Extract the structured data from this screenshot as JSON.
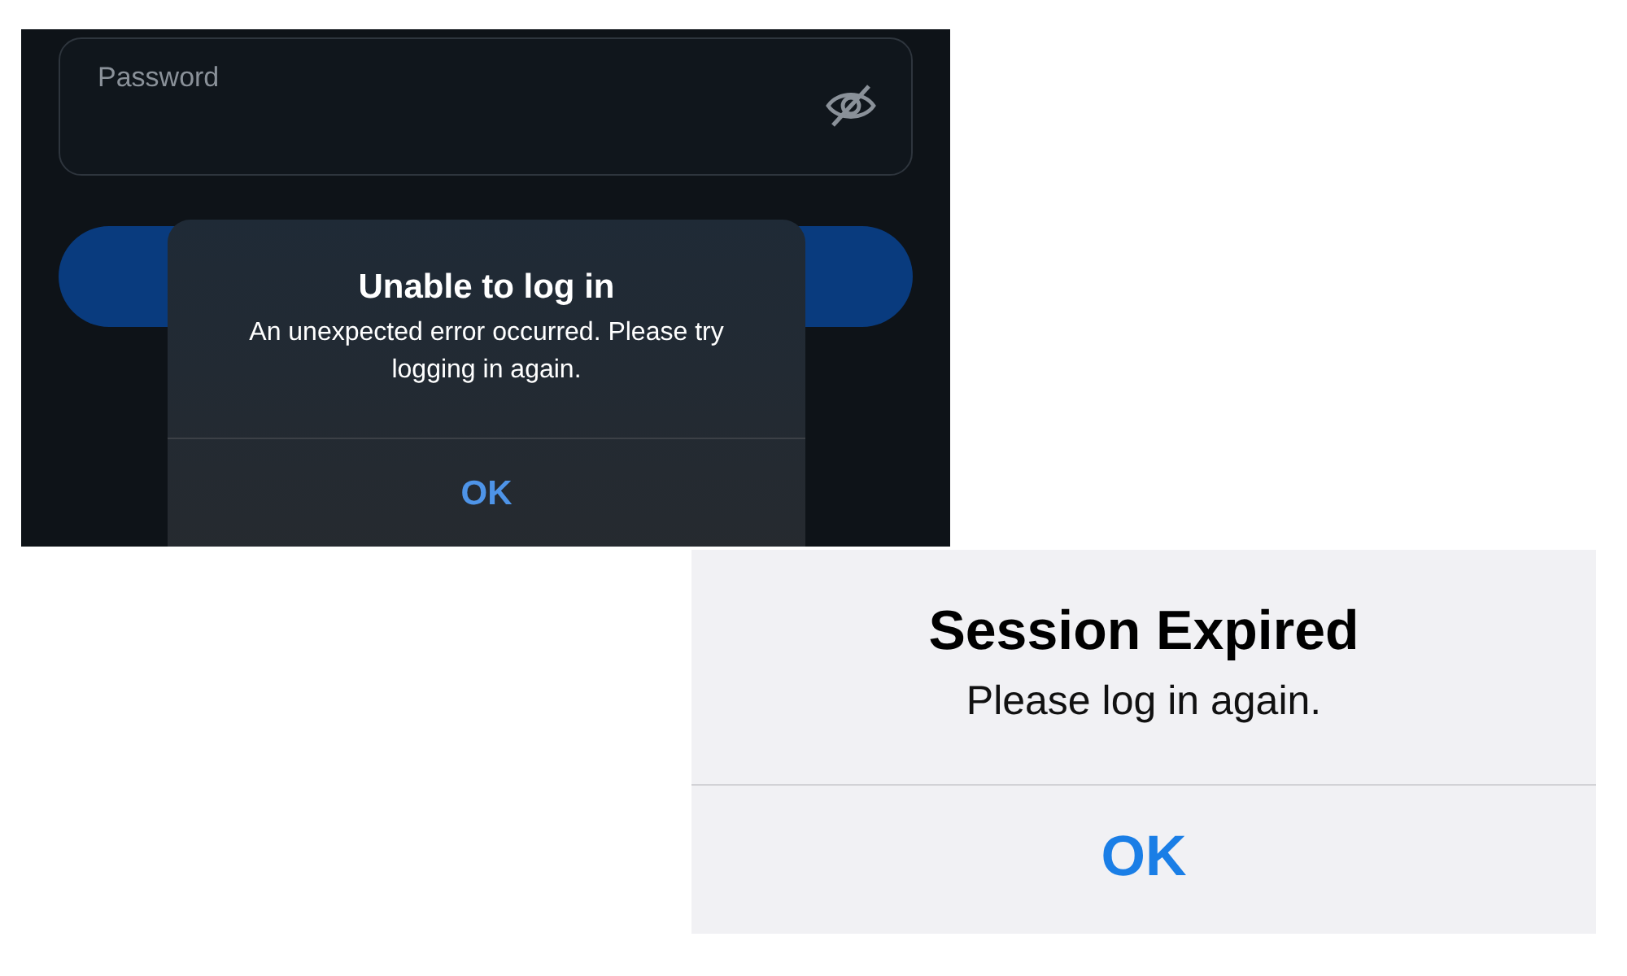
{
  "login_screen": {
    "password_field": {
      "placeholder": "Password"
    },
    "alert": {
      "title": "Unable to log in",
      "message": "An unexpected error occurred. Please try logging in again.",
      "button": "OK"
    }
  },
  "session_alert": {
    "title": "Session Expired",
    "message": "Please log in again.",
    "button": "OK"
  }
}
